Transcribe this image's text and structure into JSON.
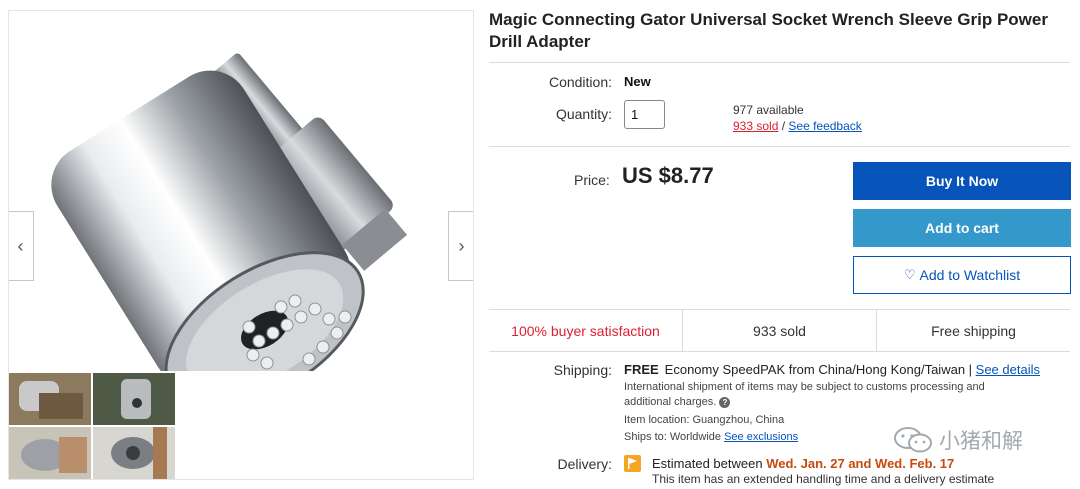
{
  "listing": {
    "title": "Magic Connecting Gator Universal Socket Wrench Sleeve Grip Power Drill Adapter"
  },
  "gallery": {
    "prev_icon": "chevron-left-icon",
    "next_icon": "chevron-right-icon"
  },
  "condition": {
    "label": "Condition:",
    "value": "New"
  },
  "quantity": {
    "label": "Quantity:",
    "value": "1",
    "available": "977 available",
    "sold_link": "933 sold",
    "separator": " / ",
    "feedback_link": "See feedback"
  },
  "price": {
    "label": "Price:",
    "value": "US $8.77"
  },
  "actions": {
    "buy_now": "Buy It Now",
    "add_to_cart": "Add to cart",
    "watchlist": "Add to Watchlist"
  },
  "stats": {
    "satisfaction": "100% buyer satisfaction",
    "sold": "933 sold",
    "shipping": "Free shipping"
  },
  "shipping": {
    "label": "Shipping:",
    "free": "FREE",
    "method": "Economy SpeedPAK from China/Hong Kong/Taiwan | ",
    "details_link": "See details",
    "note_line1": "International shipment of items may be subject to customs processing and",
    "note_line2": "additional charges.",
    "location": "Item location:  Guangzhou, China",
    "ships_to": "Ships to:  Worldwide  ",
    "exclusions_link": "See exclusions"
  },
  "delivery": {
    "label": "Delivery:",
    "prefix": "Estimated between ",
    "date_range": "Wed. Jan. 27 and Wed. Feb. 17",
    "note": "This item has an extended handling time and a delivery estimate"
  },
  "watermark": {
    "text": "小猪和解"
  },
  "colors": {
    "primary_blue": "#0654ba",
    "cart_blue": "#3498ca",
    "sold_red": "#dd1e31",
    "delivery_orange": "#c74b0b"
  }
}
